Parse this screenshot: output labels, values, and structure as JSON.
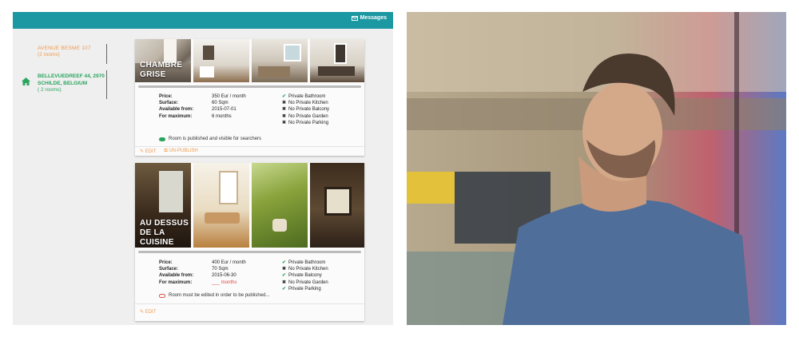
{
  "topbar": {
    "messages_label": "Messages",
    "icon": "envelope-icon"
  },
  "sidebar": {
    "items": [
      {
        "name": "AVENUE BESME 107",
        "rooms": "(2 rooms)",
        "color": "#f2994a"
      },
      {
        "name": "BELLEVUEDREEF 44, 2970 SCHILDE, BELGIUM",
        "rooms": "( 2 rooms)",
        "color": "#2aa55f",
        "icon": "home-icon"
      }
    ]
  },
  "rooms": [
    {
      "title": "CHAMBRE GRISE",
      "details": {
        "price_label": "Price:",
        "price": "350 Eur / month",
        "surface_label": "Surface:",
        "surface": "60 Sqm",
        "available_label": "Available from:",
        "available": "2015-07-01",
        "maximum_label": "For maximum:",
        "maximum": "6 months"
      },
      "amenities": [
        {
          "text": "Private Bathroom",
          "ok": true
        },
        {
          "text": "No Private Kitchen",
          "ok": false
        },
        {
          "text": "No Private Balcony",
          "ok": false
        },
        {
          "text": "No Private Garden",
          "ok": false
        },
        {
          "text": "No Private Parking",
          "ok": false
        }
      ],
      "status": "Room is published and visible for searchers",
      "actions": [
        "EDIT",
        "UN-PUBLISH"
      ]
    },
    {
      "title": "AU DESSUS DE LA CUISINE",
      "details": {
        "price_label": "Price:",
        "price": "400 Eur / month",
        "surface_label": "Surface:",
        "surface": "70 Sqm",
        "available_label": "Available from:",
        "available": "2015-06-30",
        "maximum_label": "For maximum:",
        "maximum": "___ months"
      },
      "amenities": [
        {
          "text": "Private Bathroom",
          "ok": true
        },
        {
          "text": "No Private Kitchen",
          "ok": false
        },
        {
          "text": "Private Balcony",
          "ok": true
        },
        {
          "text": "No Private Garden",
          "ok": false
        },
        {
          "text": "Private Parking",
          "ok": true
        }
      ],
      "status": "Room must be edited in order to be published...",
      "actions": [
        "EDIT"
      ]
    }
  ],
  "colors": {
    "teal": "#1b98a1",
    "orange": "#f2994a",
    "green": "#2aa55f",
    "red": "#e04848"
  }
}
